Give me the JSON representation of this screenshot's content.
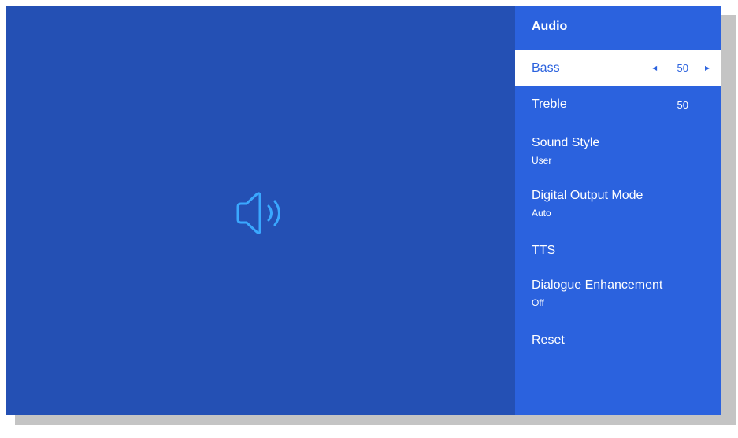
{
  "panel": {
    "title": "Audio"
  },
  "menu": {
    "bass": {
      "label": "Bass",
      "value": "50"
    },
    "treble": {
      "label": "Treble",
      "value": "50"
    },
    "sound_style": {
      "label": "Sound Style",
      "value": "User"
    },
    "digital_output_mode": {
      "label": "Digital Output Mode",
      "value": "Auto"
    },
    "tts": {
      "label": "TTS"
    },
    "dialogue_enhancement": {
      "label": "Dialogue Enhancement",
      "value": "Off"
    },
    "reset": {
      "label": "Reset"
    }
  },
  "icons": {
    "preview": "speaker-volume-icon",
    "decrease": "arrow-left-icon",
    "increase": "arrow-right-icon"
  },
  "colors": {
    "preview_background": "#2450b4",
    "panel_background": "#2b62de",
    "selected_background": "#ffffff",
    "accent_text": "#2b62de",
    "icon_stroke": "#3aa8ff"
  }
}
